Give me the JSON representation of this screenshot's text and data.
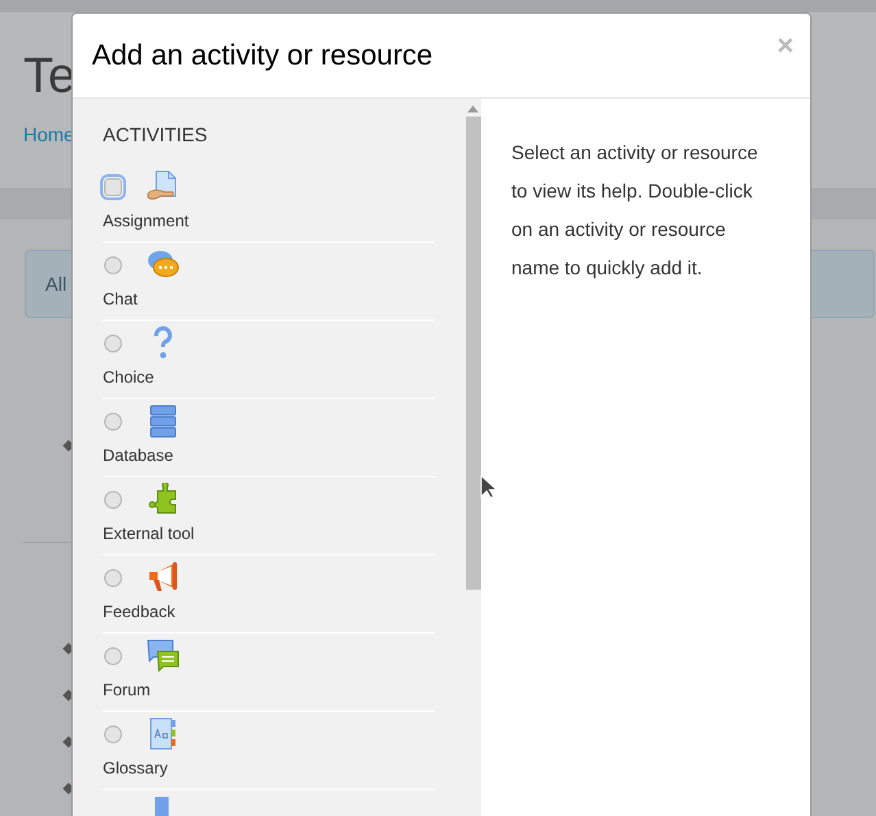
{
  "page": {
    "title": "Te",
    "breadcrumb": "Home",
    "notice": "All"
  },
  "dialog": {
    "title": "Add an activity or resource",
    "close": "×",
    "section": "ACTIVITIES",
    "items": [
      {
        "label": "Assignment",
        "kind": "assignment",
        "selected": false,
        "focused": true
      },
      {
        "label": "Chat",
        "kind": "chat",
        "selected": false,
        "focused": false
      },
      {
        "label": "Choice",
        "kind": "choice",
        "selected": false,
        "focused": false
      },
      {
        "label": "Database",
        "kind": "database",
        "selected": false,
        "focused": false
      },
      {
        "label": "External tool",
        "kind": "tool",
        "selected": false,
        "focused": false
      },
      {
        "label": "Feedback",
        "kind": "feedback",
        "selected": false,
        "focused": false
      },
      {
        "label": "Forum",
        "kind": "forum",
        "selected": false,
        "focused": false
      },
      {
        "label": "Glossary",
        "kind": "glossary",
        "selected": false,
        "focused": false
      }
    ],
    "help": "Select an activity or resource to view its help. Double-click on an activity or resource name to quickly add it."
  }
}
